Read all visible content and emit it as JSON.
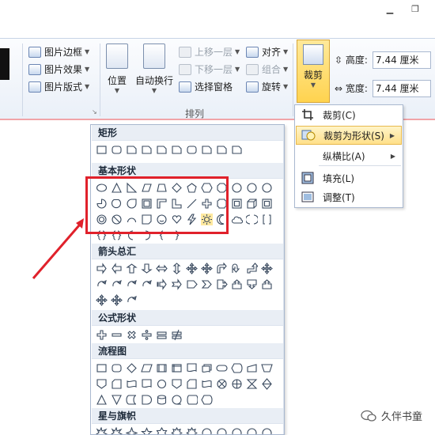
{
  "window": {
    "minimize_icon": "minimize-icon",
    "restore_icon": "restore-icon"
  },
  "ribbon": {
    "picture_styles": {
      "border": "图片边框",
      "effects": "图片效果",
      "layout": "图片版式"
    },
    "position": "位置",
    "wrap_text": "自动换行",
    "arrange": {
      "bring_forward": "上移一层",
      "send_backward": "下移一层",
      "selection_pane": "选择窗格",
      "align": "对齐",
      "group": "组合",
      "rotate": "旋转",
      "group_label": "排列"
    },
    "crop": "裁剪",
    "size": {
      "height_label": "高度:",
      "height_value": "7.44 厘米",
      "width_label": "宽度:",
      "width_value": "7.44 厘米"
    }
  },
  "crop_menu": {
    "items": [
      {
        "label": "裁剪(C)",
        "icon": "crop-icon",
        "submenu": false
      },
      {
        "label": "裁剪为形状(S)",
        "icon": "crop-to-shape-icon",
        "submenu": true,
        "selected": true
      },
      {
        "label": "纵横比(A)",
        "icon": "",
        "submenu": true
      },
      {
        "label": "填充(L)",
        "icon": "fill-icon",
        "submenu": false
      },
      {
        "label": "调整(T)",
        "icon": "fit-icon",
        "submenu": false
      }
    ]
  },
  "gallery": {
    "categories": [
      "矩形",
      "基本形状",
      "箭头总汇",
      "公式形状",
      "流程图",
      "星与旗帜"
    ]
  },
  "annotation": {
    "highlight_color": "#e0212b"
  },
  "watermark": {
    "text": "久伴书童"
  }
}
